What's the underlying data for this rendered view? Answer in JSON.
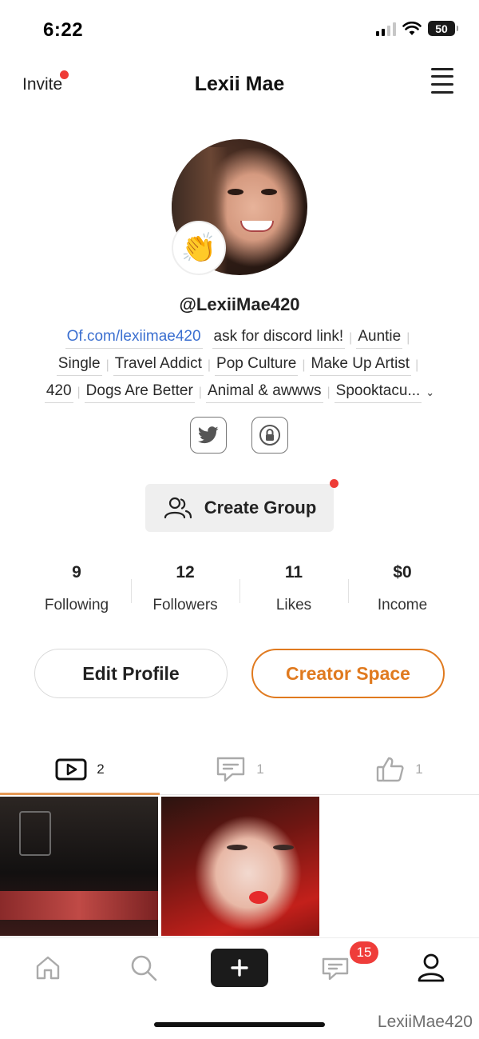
{
  "status_bar": {
    "time": "6:22",
    "battery": "50"
  },
  "header": {
    "invite_label": "Invite",
    "title": "Lexii Mae"
  },
  "profile": {
    "badge_emoji": "👏",
    "username": "@LexiiMae420",
    "bio_rows": [
      [
        "Of.com/lexiimae420",
        "ask for discord link!",
        "Auntie"
      ],
      [
        "Single",
        "Travel Addict",
        "Pop Culture",
        "Make Up Artist"
      ],
      [
        "420",
        "Dogs Are Better",
        "Animal & awwws",
        "Spooktacu..."
      ]
    ],
    "social_links": [
      "twitter-icon",
      "lock-icon"
    ]
  },
  "create_group": {
    "label": "Create Group"
  },
  "stats": [
    {
      "value": "9",
      "label": "Following"
    },
    {
      "value": "12",
      "label": "Followers"
    },
    {
      "value": "11",
      "label": "Likes"
    },
    {
      "value": "$0",
      "label": "Income"
    }
  ],
  "actions": {
    "edit_profile": "Edit Profile",
    "creator_space": "Creator Space"
  },
  "tabs": [
    {
      "icon": "video-icon",
      "count": "2"
    },
    {
      "icon": "comment-icon",
      "count": "1"
    },
    {
      "icon": "thumbs-up-icon",
      "count": "1"
    }
  ],
  "bottom_nav": {
    "messages_badge": "15"
  },
  "watermark": "LexiiMae420",
  "colors": {
    "accent": "#e07a1f",
    "link": "#3b6fd0",
    "notification": "#ee3b36"
  }
}
